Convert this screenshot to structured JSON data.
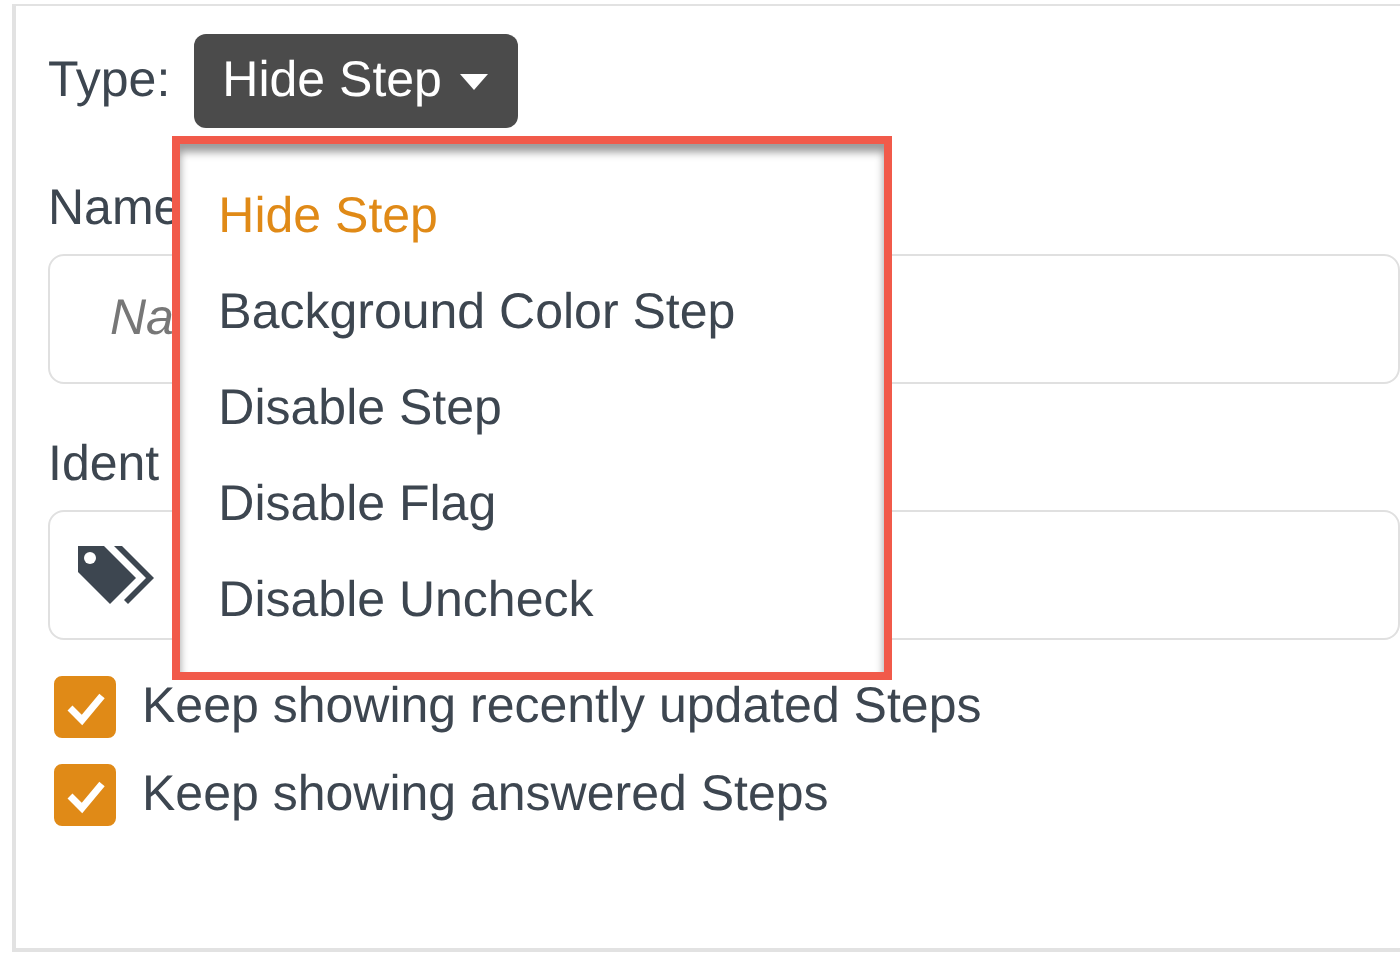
{
  "type_label": "Type:",
  "type_button": {
    "label": "Hide Step"
  },
  "menu": [
    {
      "label": "Hide Step",
      "selected": true
    },
    {
      "label": "Background Color Step",
      "selected": false
    },
    {
      "label": "Disable Step",
      "selected": false
    },
    {
      "label": "Disable Flag",
      "selected": false
    },
    {
      "label": "Disable Uncheck",
      "selected": false
    }
  ],
  "name_label": "Name",
  "name_field": {
    "placeholder": "Na"
  },
  "identifier_label": "Ident",
  "options": [
    {
      "label": "Keep showing recently updated Steps",
      "checked": true
    },
    {
      "label": "Keep showing answered Steps",
      "checked": true
    }
  ]
}
